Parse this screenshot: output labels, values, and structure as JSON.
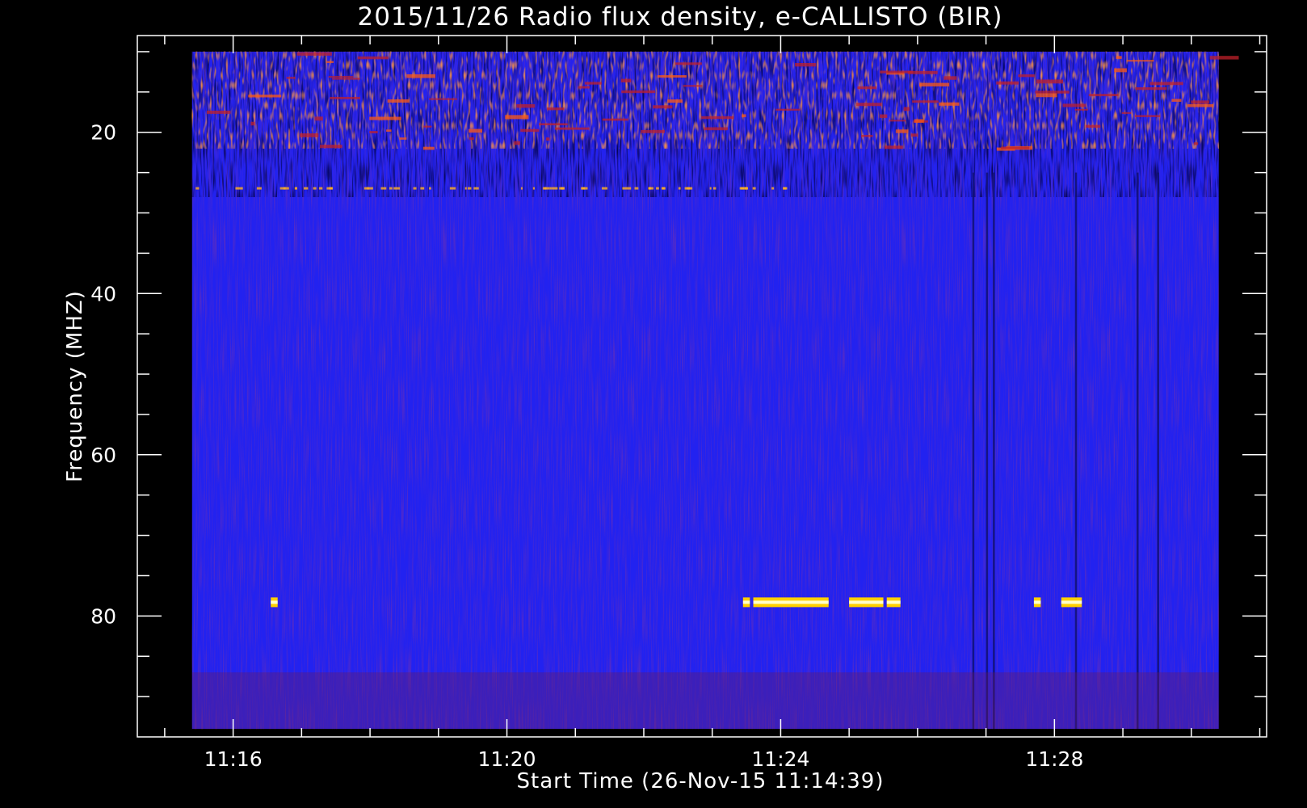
{
  "chart_data": {
    "type": "heatmap",
    "title": "2015/11/26  Radio flux density, e-CALLISTO (BIR)",
    "xlabel": "Start Time (26-Nov-15 11:14:39)",
    "ylabel": "Frequency (MHZ)",
    "x_ticks": [
      "11:16",
      "11:20",
      "11:24",
      "11:28"
    ],
    "x_tick_minutes": [
      16,
      20,
      24,
      28
    ],
    "x_range_minutes": [
      14.6,
      31.1
    ],
    "y_ticks": [
      20,
      40,
      60,
      80
    ],
    "y_range_mhz": [
      95,
      8
    ],
    "y_reversed": true,
    "data_extent": {
      "time_minutes": [
        15.4,
        30.4
      ],
      "freq_mhz": [
        10,
        94
      ]
    },
    "grid": false,
    "colormap": [
      "#000000",
      "#1a0a8c",
      "#2323ff",
      "#8b1a2a",
      "#ff3010",
      "#ffcc00",
      "#ffffcc"
    ],
    "background_color": "#2222f0",
    "features": {
      "noisy_low_band_mhz": [
        10,
        28
      ],
      "interference_line_mhz": 78.3,
      "interference_segments_minutes": [
        [
          16.55,
          16.65
        ],
        [
          23.45,
          23.55
        ],
        [
          23.6,
          24.7
        ],
        [
          25.0,
          25.5
        ],
        [
          25.55,
          25.75
        ],
        [
          27.7,
          27.8
        ],
        [
          28.1,
          28.4
        ]
      ],
      "dark_columns_minutes": [
        26.8,
        27.0,
        27.1,
        28.3,
        29.2,
        29.5
      ]
    }
  }
}
